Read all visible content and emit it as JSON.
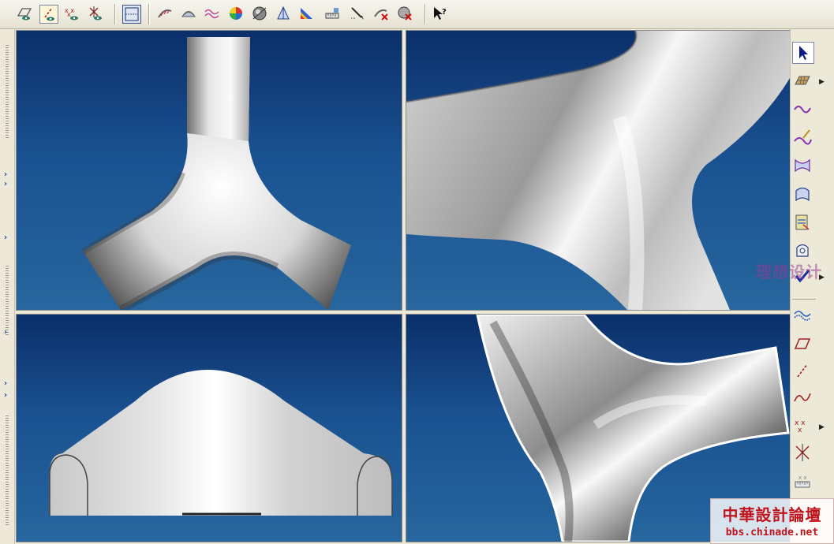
{
  "toolbar": {
    "buttons": [
      {
        "icon": "plane-eye-icon",
        "active": false
      },
      {
        "icon": "line-eye-icon",
        "active": true
      },
      {
        "icon": "points-eye-icon",
        "active": false
      },
      {
        "icon": "axis-eye-icon",
        "active": false
      },
      {
        "icon": "view-frame-icon",
        "active": false
      },
      {
        "icon": "surface-curvature-icon",
        "active": false
      },
      {
        "icon": "surface-analysis-icon",
        "active": false
      },
      {
        "icon": "curve-wave-icon",
        "active": false
      },
      {
        "icon": "color-map-icon",
        "active": false
      },
      {
        "icon": "shaded-sphere-icon",
        "active": false
      },
      {
        "icon": "draft-analysis-icon",
        "active": false
      },
      {
        "icon": "rainbow-analysis-icon",
        "active": false
      },
      {
        "icon": "ruler-measure-icon",
        "active": false
      },
      {
        "icon": "pen-measure-icon",
        "active": false
      },
      {
        "icon": "delete-analysis-icon",
        "active": false
      },
      {
        "icon": "delete-sphere-icon",
        "active": false
      },
      {
        "icon": "whats-this-help-icon",
        "active": false
      }
    ]
  },
  "right_panel": {
    "buttons": [
      {
        "icon": "select-arrow-icon"
      },
      {
        "icon": "surface-patch-icon"
      },
      {
        "icon": "curve-icon"
      },
      {
        "icon": "sketch-curve-icon"
      },
      {
        "icon": "loft-surface-icon"
      },
      {
        "icon": "sweep-surface-icon"
      },
      {
        "icon": "blend-surface-icon"
      },
      {
        "icon": "fill-surface-icon"
      },
      {
        "icon": "confirm-check-icon"
      },
      {
        "icon": "offset-curve-icon"
      },
      {
        "icon": "plane-icon"
      },
      {
        "icon": "line-icon"
      },
      {
        "icon": "spline-icon"
      },
      {
        "icon": "points-icon"
      },
      {
        "icon": "axis-icon"
      },
      {
        "icon": "ruler-icon"
      }
    ]
  },
  "viewports": [
    {
      "name": "viewport-top-left",
      "view": "top"
    },
    {
      "name": "viewport-top-right",
      "view": "perspective-closeup"
    },
    {
      "name": "viewport-bottom-left",
      "view": "front"
    },
    {
      "name": "viewport-bottom-right",
      "view": "perspective"
    }
  ],
  "watermark": {
    "top_text": "理想设计",
    "bottom_title": "中華設計論壇",
    "bottom_url": "bbs.chinade.net"
  },
  "colors": {
    "viewport_top": "#0b2f6a",
    "viewport_bottom": "#27669e",
    "model_surface": "#e8e8e8",
    "watermark_red": "#c0141c"
  }
}
